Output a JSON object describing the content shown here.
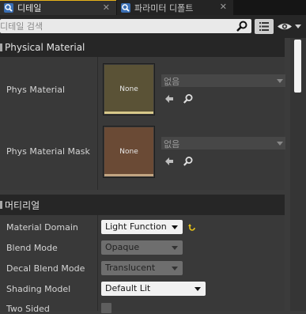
{
  "tabs": [
    {
      "label": "디테일",
      "icon": "details-magnifier-icon",
      "close": "✕"
    },
    {
      "label": "파라미터 디폴트",
      "icon": "parameter-magnifier-icon",
      "close": "✕"
    }
  ],
  "search": {
    "placeholder": "디테일 검색"
  },
  "colors": {
    "accent": "#e6b21a",
    "tab_active": "#303030",
    "panel_bg": "#393939",
    "category_bg": "#262626"
  },
  "categories": {
    "physical_material": {
      "title": "Physical Material",
      "properties": [
        {
          "label": "Phys Material",
          "thumb_text": "None",
          "asset_value": "없음"
        },
        {
          "label": "Phys Material Mask",
          "thumb_text": "None",
          "asset_value": "없음"
        }
      ]
    },
    "material": {
      "title": "머티리얼",
      "properties": [
        {
          "label": "Material Domain",
          "value": "Light Function"
        },
        {
          "label": "Blend Mode",
          "value": "Opaque"
        },
        {
          "label": "Decal Blend Mode",
          "value": "Translucent"
        },
        {
          "label": "Shading Model",
          "value": "Default Lit"
        },
        {
          "label": "Two Sided",
          "value": false
        }
      ]
    }
  }
}
